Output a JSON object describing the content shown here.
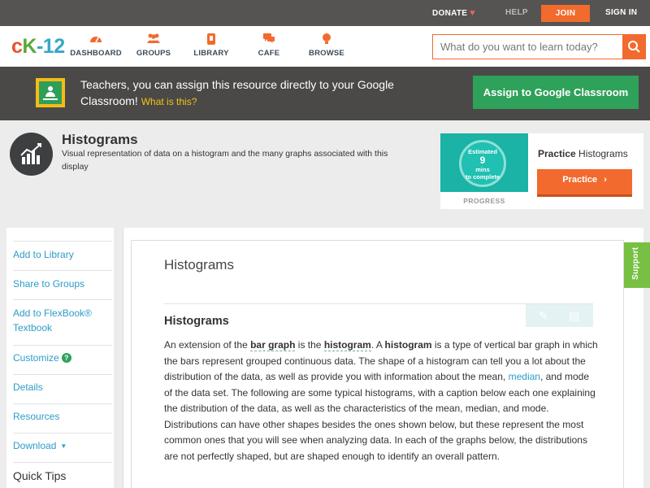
{
  "topbar": {
    "donate": "DONATE",
    "help": "HELP",
    "join": "JOIN",
    "sign_in": "SIGN IN"
  },
  "logo": {
    "c": "c",
    "k": "K",
    "n": "-12"
  },
  "nav": [
    {
      "label": "DASHBOARD",
      "icon": "dashboard-icon"
    },
    {
      "label": "GROUPS",
      "icon": "groups-icon"
    },
    {
      "label": "LIBRARY",
      "icon": "library-icon"
    },
    {
      "label": "CAFE",
      "icon": "cafe-icon"
    },
    {
      "label": "BROWSE",
      "icon": "browse-icon"
    }
  ],
  "search": {
    "placeholder": "What do you want to learn today?"
  },
  "google_banner": {
    "text": "Teachers, you can assign this resource directly to your Google Classroom!",
    "what_link": "What is this?",
    "assign_button": "Assign to Google Classroom"
  },
  "concept": {
    "title": "Histograms",
    "description": "Visual representation of data on a histogram and the many graphs associated with this display"
  },
  "practice": {
    "estimate_line1": "Estimated",
    "estimate_mins": "9",
    "estimate_line2": "mins",
    "estimate_line3": "to complete",
    "progress_label": "PROGRESS",
    "title_bold": "Practice",
    "title_rest": "Histograms",
    "button": "Practice"
  },
  "sidebar": {
    "items": [
      "Add to Library",
      "Share to Groups",
      "Add to FlexBook® Textbook",
      "Customize",
      "Details",
      "Resources",
      "Download"
    ],
    "customize_badge": "?",
    "quick_tips": "Quick Tips"
  },
  "content": {
    "heading": "Histograms",
    "section_title": "Histograms",
    "p_intro1": "An extension of the",
    "term_bar_graph": "bar graph",
    "p_intro2": "is the",
    "term_histogram1": "histogram",
    "p_intro3": ". A",
    "term_histogram2": "histogram",
    "p_body1": "is a type of vertical bar graph in which the bars represent grouped continuous data. The shape of a histogram can tell you a lot about the distribution of the data, as well as provide you with information about the mean,",
    "term_median": "median",
    "p_body2": ", and mode of the data set. The following are some typical histograms, with a caption below each one explaining the distribution of the data, as well as the characteristics of the mean, median, and mode. Distributions can have other shapes besides the ones shown below, but these represent the most common ones that you will see when analyzing data. In each of the graphs below, the distributions are not perfectly shaped, but are shaped enough to identify an overall pattern."
  },
  "support_tab": "Support",
  "colors": {
    "accent_orange": "#f26a2e",
    "google_green": "#2ea15a",
    "link_blue": "#2b9cc8",
    "support_green": "#78c043"
  }
}
